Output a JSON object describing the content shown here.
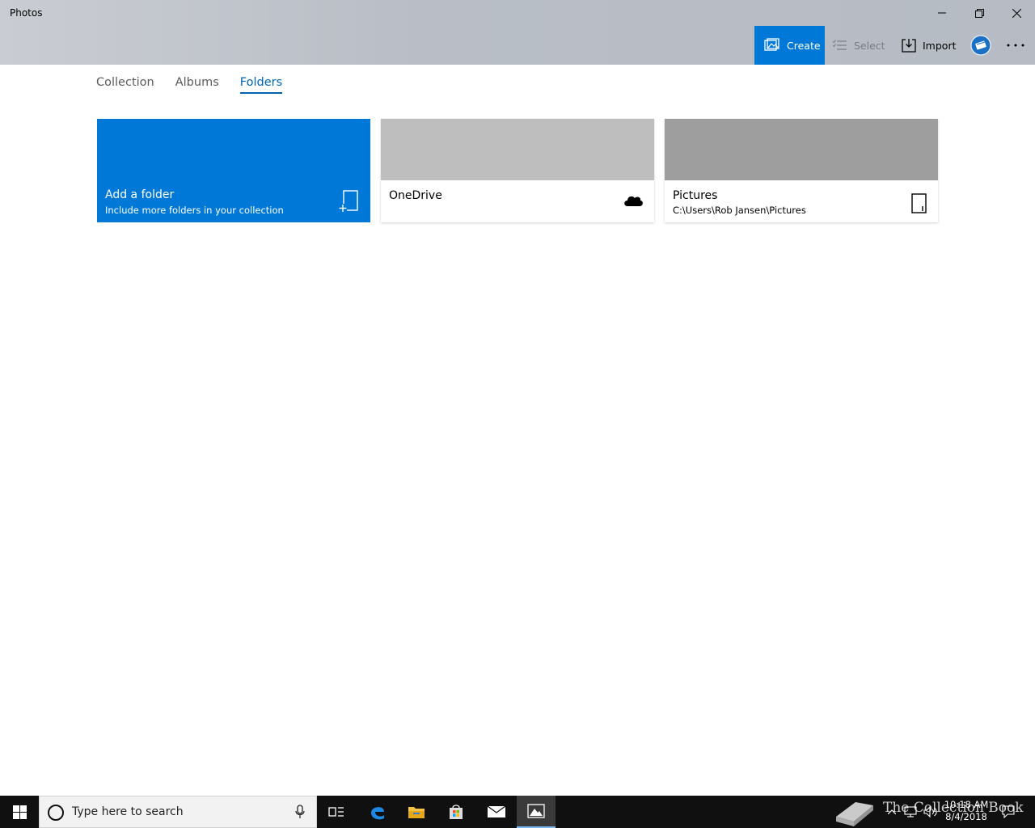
{
  "window": {
    "title": "Photos",
    "controls": {
      "minimize": "minimize-icon",
      "maximize": "restore-icon",
      "close": "close-icon"
    }
  },
  "commands": {
    "create": "Create",
    "select": "Select",
    "import": "Import",
    "more": "more-icon"
  },
  "tabs": [
    {
      "label": "Collection",
      "active": false
    },
    {
      "label": "Albums",
      "active": false
    },
    {
      "label": "Folders",
      "active": true
    }
  ],
  "folders": {
    "add": {
      "title": "Add a folder",
      "subtitle": "Include more folders in your collection",
      "icon": "add-folder-icon"
    },
    "onedrive": {
      "title": "OneDrive",
      "icon": "cloud-icon"
    },
    "pictures": {
      "title": "Pictures",
      "path": "C:\\Users\\Rob Jansen\\Pictures",
      "icon": "device-icon"
    }
  },
  "taskbar": {
    "search_placeholder": "Type here to search",
    "time": "10:18 AM",
    "date": "8/4/2018",
    "watermark": "The Collection Book"
  },
  "colors": {
    "accent": "#0078d7",
    "tab_active": "#0063b1",
    "taskbar": "#101010"
  }
}
